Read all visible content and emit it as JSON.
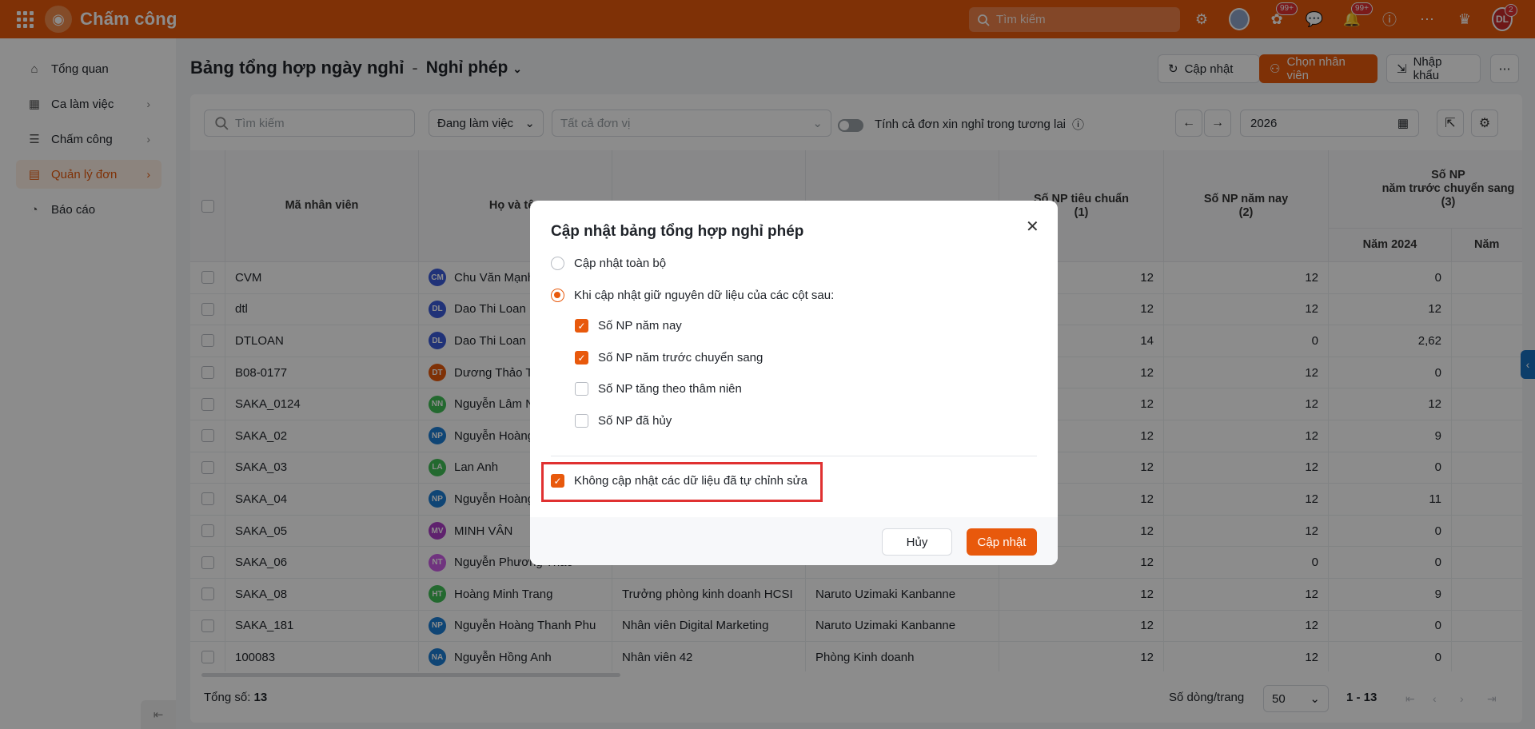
{
  "app": {
    "name": "Chấm công",
    "search_placeholder": "Tìm kiếm",
    "badges": {
      "gift": "99+",
      "bell": "99+",
      "avatar": "2"
    },
    "user_initials": "DL"
  },
  "sidebar": {
    "items": [
      {
        "label": "Tổng quan",
        "icon": "home-icon",
        "chevron": false,
        "active": false
      },
      {
        "label": "Ca làm việc",
        "icon": "calendar-icon",
        "chevron": true,
        "active": false
      },
      {
        "label": "Chấm công",
        "icon": "checklist-icon",
        "chevron": true,
        "active": false
      },
      {
        "label": "Quản lý đơn",
        "icon": "document-icon",
        "chevron": true,
        "active": true
      },
      {
        "label": "Báo cáo",
        "icon": "pie-chart-icon",
        "chevron": false,
        "active": false
      }
    ]
  },
  "page": {
    "title": "Bảng tổng hợp ngày nghỉ",
    "separator": "-",
    "subtitle": "Nghỉ phép",
    "buttons": {
      "update": "Cập nhật",
      "choose_employee": "Chọn nhân viên",
      "import": "Nhập khẩu"
    }
  },
  "filters": {
    "search_placeholder": "Tìm kiếm",
    "status": "Đang làm việc",
    "unit_placeholder": "Tất cả đơn vị",
    "future_toggle_label": "Tính cả đơn xin nghỉ trong tương lai",
    "year": "2026"
  },
  "table": {
    "headers": {
      "code": "Mã nhân viên",
      "name": "Họ và tên",
      "standard": "Số NP tiêu chuẩn\n(1)",
      "this_year": "Số NP năm nay\n(2)",
      "carry": "Số NP\nnăm trước chuyển sang\n(3)",
      "y2024": "Năm 2024",
      "y_next": "Năm"
    },
    "rows": [
      {
        "code": "CVM",
        "initials": "CM",
        "color": "#3b5bdb",
        "name": "Chu Văn Mạnh",
        "position": "",
        "unit": "",
        "standard": "12",
        "this_year": "12",
        "y2024": "0"
      },
      {
        "code": "dtl",
        "initials": "DL",
        "color": "#3b5bdb",
        "name": "Dao Thi Loan",
        "position": "",
        "unit": "",
        "standard": "12",
        "this_year": "12",
        "y2024": "12"
      },
      {
        "code": "DTLOAN",
        "initials": "DL",
        "color": "#3b5bdb",
        "name": "Dao Thi Loan",
        "position": "",
        "unit": "",
        "standard": "14",
        "this_year": "0",
        "y2024": "2,62"
      },
      {
        "code": "B08-0177",
        "initials": "DT",
        "color": "#e8590c",
        "name": "Dương Thảo Tâm",
        "position": "",
        "unit": "",
        "standard": "12",
        "this_year": "12",
        "y2024": "0"
      },
      {
        "code": "SAKA_0124",
        "initials": "NN",
        "color": "#40c057",
        "name": "Nguyễn Lâm Ngọc",
        "position": "",
        "unit": "",
        "standard": "12",
        "this_year": "12",
        "y2024": "12"
      },
      {
        "code": "SAKA_02",
        "initials": "NP",
        "color": "#1c7ed6",
        "name": "Nguyễn Hoàng Phú",
        "position": "",
        "unit": "",
        "standard": "12",
        "this_year": "12",
        "y2024": "9"
      },
      {
        "code": "SAKA_03",
        "initials": "LA",
        "color": "#40c057",
        "name": "Lan Anh",
        "position": "",
        "unit": "",
        "standard": "12",
        "this_year": "12",
        "y2024": "0"
      },
      {
        "code": "SAKA_04",
        "initials": "NP",
        "color": "#1c7ed6",
        "name": "Nguyễn Hoàng Phú",
        "position": "",
        "unit": "",
        "standard": "12",
        "this_year": "12",
        "y2024": "11"
      },
      {
        "code": "SAKA_05",
        "initials": "MV",
        "color": "#ae3ec9",
        "name": "MINH VÂN",
        "position": "",
        "unit": "",
        "standard": "12",
        "this_year": "12",
        "y2024": "0"
      },
      {
        "code": "SAKA_06",
        "initials": "NT",
        "color": "#cc5de8",
        "name": "Nguyễn Phương Thảo",
        "position": "",
        "unit": "",
        "standard": "12",
        "this_year": "0",
        "y2024": "0"
      },
      {
        "code": "SAKA_08",
        "initials": "HT",
        "color": "#40c057",
        "name": "Hoàng Minh Trang",
        "position": "Trưởng phòng kinh doanh HCSI",
        "unit": "Naruto Uzimaki Kanbanne",
        "standard": "12",
        "this_year": "12",
        "y2024": "9"
      },
      {
        "code": "SAKA_181",
        "initials": "NP",
        "color": "#1c7ed6",
        "name": "Nguyễn Hoàng Thanh Phu",
        "position": "Nhân viên Digital Marketing",
        "unit": "Naruto Uzimaki Kanbanne",
        "standard": "12",
        "this_year": "12",
        "y2024": "0"
      },
      {
        "code": "100083",
        "initials": "NA",
        "color": "#1c7ed6",
        "name": "Nguyễn Hồng Anh",
        "position": "Nhân viên 42",
        "unit": "Phòng Kinh doanh",
        "standard": "12",
        "this_year": "12",
        "y2024": "0"
      }
    ]
  },
  "footer": {
    "total_label": "Tổng số:",
    "total": "13",
    "rows_per_page_label": "Số dòng/trang",
    "rows_per_page": "50",
    "range": "1 - 13"
  },
  "modal": {
    "title": "Cập nhật bảng tổng hợp nghỉ phép",
    "option_all": "Cập nhật toàn bộ",
    "option_keep": "Khi cập nhật giữ nguyên dữ liệu của các cột sau:",
    "columns": [
      {
        "label": "Số NP năm nay",
        "checked": true
      },
      {
        "label": "Số NP năm trước chuyển sang",
        "checked": true
      },
      {
        "label": "Số NP tăng theo thâm niên",
        "checked": false
      },
      {
        "label": "Số NP đã hủy",
        "checked": false
      }
    ],
    "no_update_edited": "Không cập nhật các dữ liệu đã tự chỉnh sửa",
    "cancel": "Hủy",
    "confirm": "Cập nhật"
  },
  "colors": {
    "accent": "#e8590c",
    "highlight_border": "#e03131"
  }
}
